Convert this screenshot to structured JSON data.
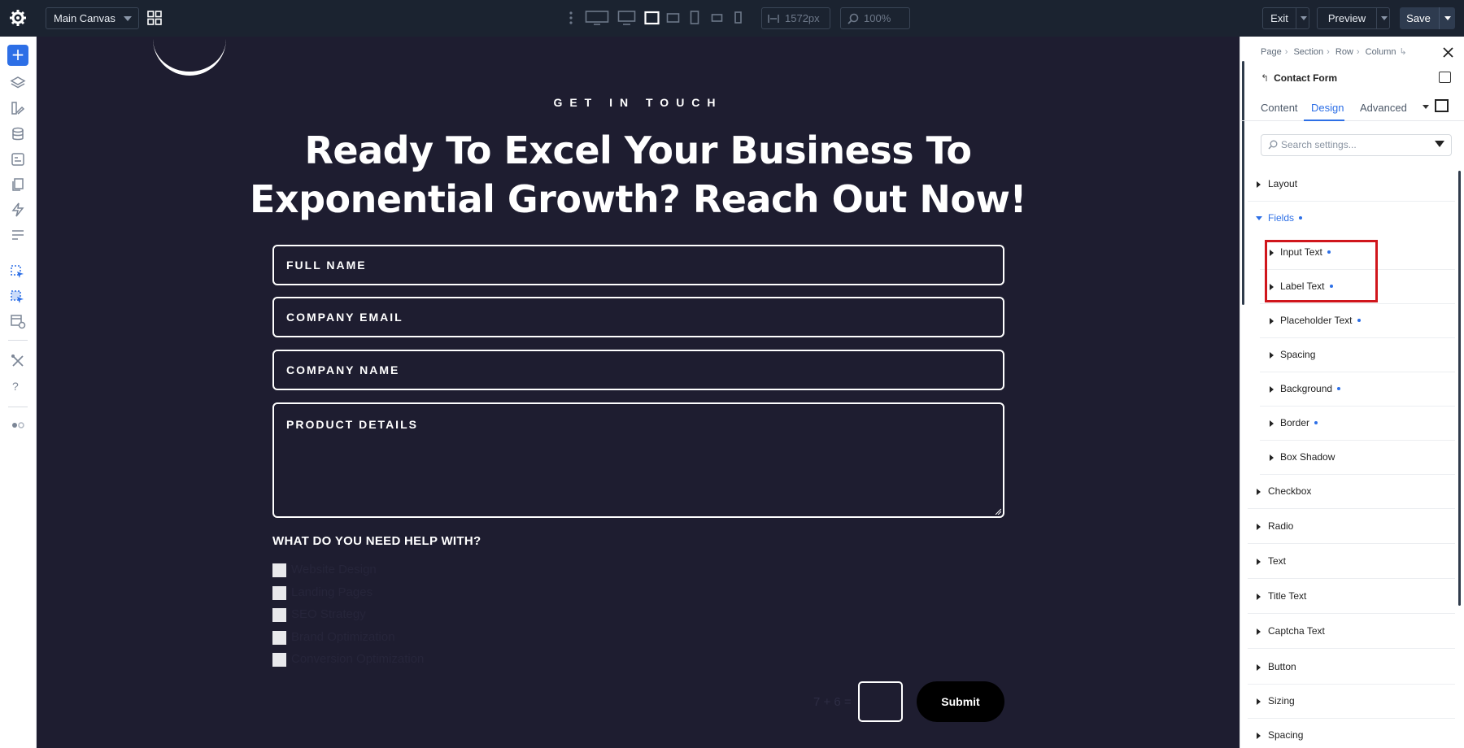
{
  "topbar": {
    "canvas_select": "Main Canvas",
    "width_value": "1572px",
    "zoom_value": "100%",
    "exit_label": "Exit",
    "preview_label": "Preview",
    "save_label": "Save"
  },
  "canvas": {
    "eyebrow": "GET IN TOUCH",
    "headline_line1": "Ready To Excel Your Business To",
    "headline_line2": "Exponential Growth? Reach Out Now!",
    "fields": [
      "FULL NAME",
      "COMPANY EMAIL",
      "COMPANY NAME",
      "PRODUCT DETAILS"
    ],
    "help_title": "WHAT DO YOU NEED HELP WITH?",
    "checkboxes": [
      "Website Design",
      "Landing Pages",
      "SEO Strategy",
      "Brand Optimization",
      "Conversion Optimization"
    ],
    "captcha_question": "7 + 6 =",
    "submit_label": "Submit",
    "background_color": "#1e1d30"
  },
  "panel": {
    "breadcrumbs": [
      "Page",
      "Section",
      "Row",
      "Column"
    ],
    "title": "Contact Form",
    "tabs": [
      "Content",
      "Design",
      "Advanced"
    ],
    "active_tab": "Design",
    "search_placeholder": "Search settings...",
    "groups": [
      "Layout",
      "Fields",
      "Checkbox",
      "Radio",
      "Text",
      "Title Text",
      "Captcha Text",
      "Button",
      "Sizing",
      "Spacing"
    ],
    "field_subgroups": [
      "Input Text",
      "Label Text",
      "Placeholder Text",
      "Spacing",
      "Background",
      "Border",
      "Box Shadow"
    ],
    "accent_color": "#2d6fe6",
    "highlight_color": "#d0161c"
  }
}
